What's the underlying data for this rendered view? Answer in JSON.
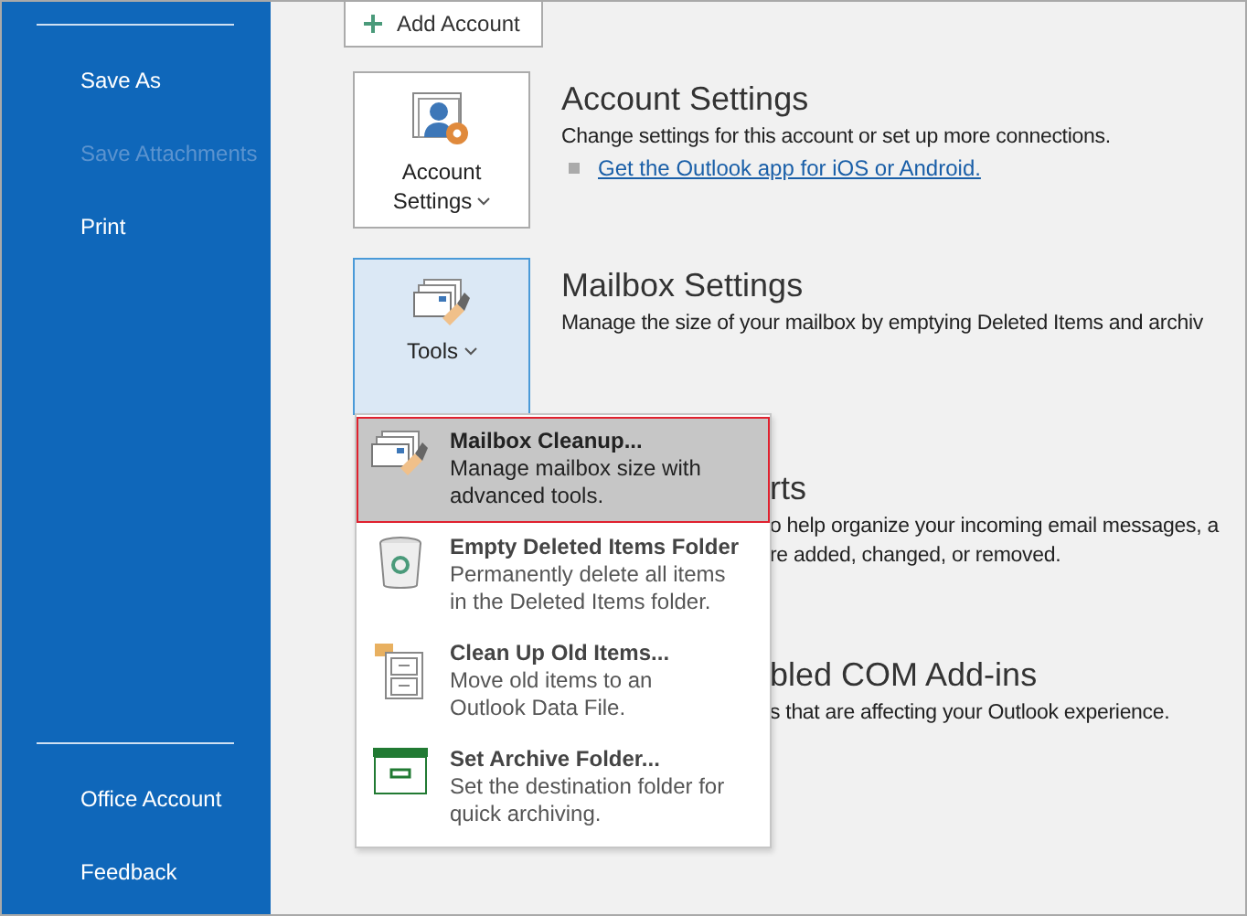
{
  "sidebar": {
    "items": [
      {
        "label": "Save As",
        "disabled": false
      },
      {
        "label": "Save Attachments",
        "disabled": true
      },
      {
        "label": "Print",
        "disabled": false
      }
    ],
    "bottom_items": [
      {
        "label": "Office Account"
      },
      {
        "label": "Feedback"
      }
    ]
  },
  "add_account_button": "Add Account",
  "sections": [
    {
      "kind": "button",
      "button_label": "Account Settings",
      "pressed": false,
      "heading": "Account Settings",
      "lines": [
        "Change settings for this account or set up more connections."
      ],
      "link": "Get the Outlook app for iOS or Android."
    },
    {
      "kind": "button",
      "button_label": "Tools",
      "pressed": true,
      "heading": "Mailbox Settings",
      "lines": [
        "Manage the size of your mailbox by emptying Deleted Items and archiv"
      ]
    },
    {
      "kind": "partial",
      "heading": "rts",
      "lines": [
        "o help organize your incoming email messages, a",
        "re added, changed, or removed."
      ]
    },
    {
      "kind": "partial",
      "heading": "bled COM Add-ins",
      "lines": [
        "s that are affecting your Outlook experience."
      ]
    }
  ],
  "dropdown_menu": {
    "items": [
      {
        "title": "Mailbox Cleanup...",
        "lines": [
          "Manage mailbox size with",
          "advanced tools."
        ],
        "selected": true
      },
      {
        "title": "Empty Deleted Items Folder",
        "lines": [
          "Permanently delete all items",
          "in the Deleted Items folder."
        ],
        "selected": false
      },
      {
        "title": "Clean Up Old Items...",
        "lines": [
          "Move old items to an",
          "Outlook Data File."
        ],
        "selected": false
      },
      {
        "title": "Set Archive Folder...",
        "lines": [
          "Set the destination folder for",
          "quick archiving."
        ],
        "selected": false
      }
    ]
  }
}
